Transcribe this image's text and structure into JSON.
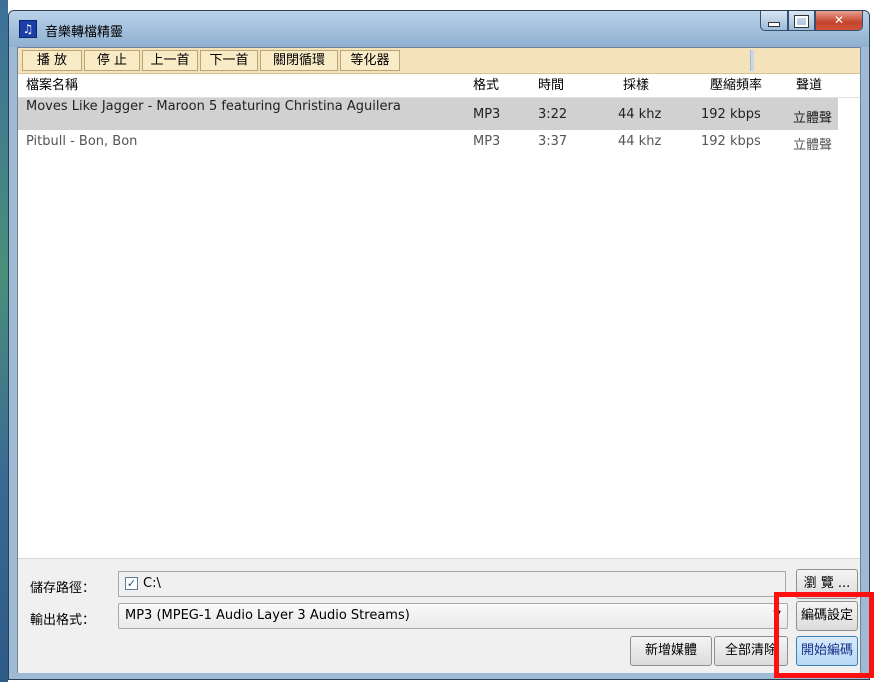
{
  "window": {
    "title": "音樂轉檔精靈",
    "icon": "music-note-icon",
    "controls": [
      "minimize-icon",
      "maximize-icon",
      "close-icon"
    ]
  },
  "toolbar": {
    "play": "播 放",
    "stop": "停 止",
    "prev": "上一首",
    "next": "下一首",
    "loop": "關閉循環",
    "equalizer": "等化器"
  },
  "list": {
    "columns": {
      "name": "檔案名稱",
      "format": "格式",
      "time": "時間",
      "sample": "採樣",
      "bitrate": "壓縮頻率",
      "channel": "聲道"
    },
    "rows": [
      {
        "name": "Moves Like Jagger - Maroon 5 featuring Christina Aguilera",
        "format": "MP3",
        "time": "3:22",
        "sample": "44 khz",
        "bitrate": "192 kbps",
        "channel": "立體聲"
      },
      {
        "name": "Pitbull - Bon, Bon",
        "format": "MP3",
        "time": "3:37",
        "sample": "44 khz",
        "bitrate": "192 kbps",
        "channel": "立體聲"
      }
    ]
  },
  "output": {
    "path_label": "儲存路徑：",
    "path_value": "C:\\",
    "browse_label": "瀏 覽 ...",
    "format_label": "輸出格式：",
    "format_value": "MP3  (MPEG-1 Audio Layer 3 Audio Streams)",
    "encode_settings_label": "編碼設定"
  },
  "actions": {
    "add_media": "新增媒體",
    "clear_all": "全部清除",
    "start_encode": "開始編碼"
  },
  "colors": {
    "toolbar_bg": "#f4e3ba",
    "selected_row": "#d1d1d1",
    "highlight": "#ff1010"
  }
}
